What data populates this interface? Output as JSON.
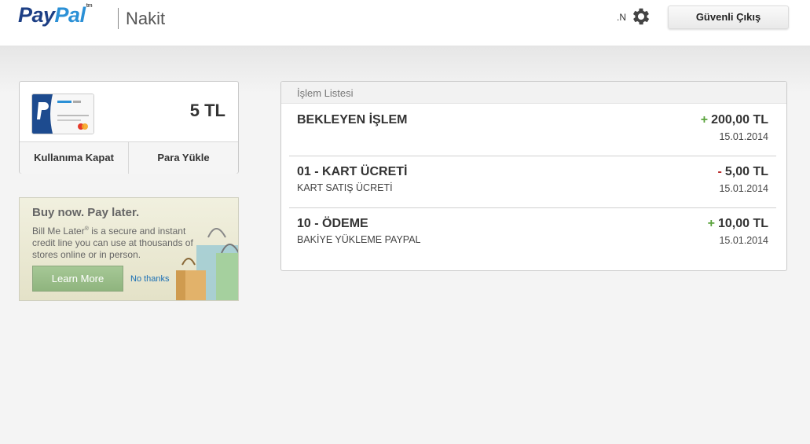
{
  "header": {
    "logo_pay": "Pay",
    "logo_pal": "Pal",
    "logo_tm": "tm",
    "product": "Nakit",
    "user_initial": ".N",
    "logout_label": "Güvenli Çıkış"
  },
  "balance": {
    "amount": "5 TL",
    "close_label": "Kullanıma Kapat",
    "load_label": "Para Yükle"
  },
  "ad": {
    "title": "Buy now. Pay later.",
    "text_brand": "Bill Me Later",
    "text_reg": "®",
    "text_body": " is a secure and instant credit line you can use at thousands of stores online or in person.",
    "learn_more": "Learn More",
    "no_thanks": "No thanks"
  },
  "transactions": {
    "title": "İşlem Listesi",
    "items": [
      {
        "name": "BEKLEYEN İŞLEM",
        "detail": "",
        "sign": "+",
        "amount": "200,00 TL",
        "date": "15.01.2014"
      },
      {
        "name": "01 - KART ÜCRETİ",
        "detail": "KART SATIŞ ÜCRETİ",
        "sign": "-",
        "amount": "5,00 TL",
        "date": "15.01.2014"
      },
      {
        "name": "10 - ÖDEME",
        "detail": "BAKİYE YÜKLEME PAYPAL",
        "sign": "+",
        "amount": "10,00 TL",
        "date": "15.01.2014"
      }
    ]
  },
  "colors": {
    "brand_dark": "#1d3f85",
    "brand_light": "#2b90d6",
    "positive": "#5aa33c",
    "negative": "#b82a2a"
  }
}
